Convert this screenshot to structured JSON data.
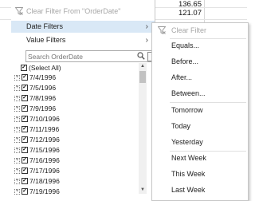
{
  "sheet": {
    "cell_values": [
      "136.65",
      "121.07"
    ]
  },
  "filter_menu": {
    "clear_filter_label": "Clear Filter From \"OrderDate\"",
    "date_filters_label": "Date Filters",
    "value_filters_label": "Value Filters",
    "search": {
      "placeholder": "Search OrderDate",
      "value": ""
    },
    "tree_items": [
      "(Select All)",
      "7/4/1996",
      "7/5/1996",
      "7/8/1996",
      "7/9/1996",
      "7/10/1996",
      "7/11/1996",
      "7/12/1996",
      "7/15/1996",
      "7/16/1996",
      "7/17/1996",
      "7/18/1996",
      "7/19/1996"
    ]
  },
  "date_submenu": {
    "clear_filter_label": "Clear Filter",
    "items": [
      "Equals...",
      "Before...",
      "After...",
      "Between...",
      "Tomorrow",
      "Today",
      "Yesterday",
      "Next Week",
      "This Week",
      "Last Week"
    ]
  },
  "icons": {
    "funnel": "funnel-icon",
    "search": "search-icon",
    "chevron": "chevron-right-icon",
    "checkbox": "checked-checkbox",
    "expander": "expand-plus-icon"
  },
  "colors": {
    "menu_highlight": "#d9e8f6",
    "disabled_text": "#a6a6a6",
    "grid_line": "#d9d9d9"
  }
}
